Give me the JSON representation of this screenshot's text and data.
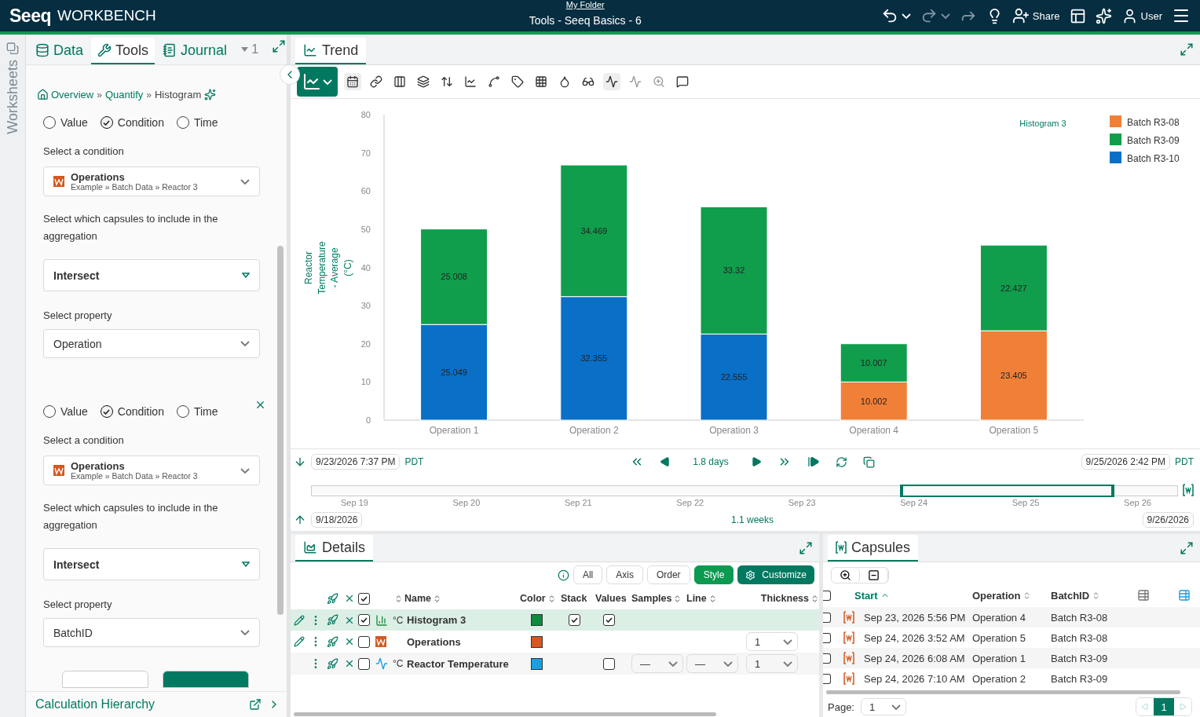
{
  "header": {
    "logo": "Seeq",
    "product": "WORKBENCH",
    "folder_link": "My Folder",
    "document_title": "Tools - Seeq Basics - 6",
    "share": "Share",
    "user": "User"
  },
  "side_tab": "Worksheets",
  "tool_tabs": [
    {
      "label": "Data",
      "selected": false
    },
    {
      "label": "Tools",
      "selected": true
    },
    {
      "label": "Journal",
      "selected": false
    }
  ],
  "tab_count": "1",
  "breadcrumbs": [
    "Overview",
    "Quantify",
    "Histogram"
  ],
  "breadcrumb_separator": "»",
  "aggregations": [
    {
      "removable": false,
      "types": [
        {
          "label": "Value",
          "selected": false
        },
        {
          "label": "Condition",
          "selected": true
        },
        {
          "label": "Time",
          "selected": false
        }
      ],
      "condition_label": "Select a condition",
      "condition": {
        "name": "Operations",
        "path": "Example » Batch Data » Reactor 3"
      },
      "capsules_label": "Select which capsules to include in the aggregation",
      "capsule_mode": "Intersect",
      "property_label": "Select property",
      "property": "Operation"
    },
    {
      "removable": true,
      "types": [
        {
          "label": "Value",
          "selected": false
        },
        {
          "label": "Condition",
          "selected": true
        },
        {
          "label": "Time",
          "selected": false
        }
      ],
      "condition_label": "Select a condition",
      "condition": {
        "name": "Operations",
        "path": "Example » Batch Data » Reactor 3"
      },
      "capsules_label": "Select which capsules to include in the aggregation",
      "capsule_mode": "Intersect",
      "property_label": "Select property",
      "property": "BatchID"
    }
  ],
  "calc_hierarchy": "Calculation Hierarchy",
  "trend_tab": "Trend",
  "chart_data": {
    "type": "bar",
    "stacked": true,
    "title": "Histogram 3",
    "ylabel": "Reactor Temperature - Average (°C)",
    "legend": true,
    "categories": [
      "Operation 1",
      "Operation 2",
      "Operation 3",
      "Operation 4",
      "Operation 5"
    ],
    "ylim": [
      0,
      80
    ],
    "yticks": [
      0,
      10,
      20,
      30,
      40,
      50,
      60,
      70,
      80
    ],
    "data_labels": true,
    "series": [
      {
        "name": "Batch R3-08",
        "color": "#f07f38",
        "values": [
          null,
          null,
          null,
          10.002,
          23.405
        ]
      },
      {
        "name": "Batch R3-10",
        "color": "#0a6fc7",
        "values": [
          25.049,
          32.355,
          22.555,
          null,
          null
        ]
      },
      {
        "name": "Batch R3-09",
        "color": "#109e4c",
        "values": [
          25.008,
          34.469,
          33.32,
          10.007,
          22.427
        ]
      }
    ]
  },
  "time_bar": {
    "start": "9/23/2026 7:37 PM",
    "start_zone": "PDT",
    "duration": "1.8 days",
    "end": "9/25/2026 2:42 PM",
    "end_zone": "PDT"
  },
  "overview": {
    "ticks": [
      "Sep 19",
      "Sep 20",
      "Sep 21",
      "Sep 22",
      "Sep 23",
      "Sep 24",
      "Sep 25",
      "Sep 26"
    ],
    "start": "9/18/2026",
    "span": "1.1 weeks",
    "end": "9/26/2026"
  },
  "details": {
    "title": "Details",
    "filters": [
      {
        "label": "All",
        "selected": false
      },
      {
        "label": "Axis",
        "selected": false
      },
      {
        "label": "Order",
        "selected": false
      },
      {
        "label": "Style",
        "selected": true
      }
    ],
    "customize": "Customize",
    "all_checked": true,
    "columns": [
      "Name",
      "Color",
      "Stack",
      "Values",
      "Samples",
      "Line",
      "Thickness"
    ],
    "rows": [
      {
        "kind": "histogram",
        "unit": "°C",
        "name": "Histogram 3",
        "color": "#0f8a3e",
        "checked": true,
        "selected": true,
        "editable": true,
        "stack": true,
        "values": true
      },
      {
        "kind": "condition",
        "name": "Operations",
        "color": "#d4581f",
        "checked": false,
        "selected": false,
        "editable": true,
        "thickness": "1"
      },
      {
        "kind": "signal",
        "unit": "°C",
        "name": "Reactor Temperature",
        "color": "#1b9fe0",
        "checked": false,
        "selected": false,
        "editable": false,
        "values": false,
        "samples": "—",
        "line": "—",
        "thickness": "1"
      }
    ]
  },
  "capsules": {
    "title": "Capsules",
    "all_checked": false,
    "columns": [
      {
        "label": "Start",
        "sorted": true
      },
      {
        "label": "Operation",
        "sorted": false
      },
      {
        "label": "BatchID",
        "sorted": false
      }
    ],
    "rows": [
      {
        "checked": false,
        "start": "Sep 23, 2026 5:56 PM",
        "operation": "Operation 4",
        "batch": "Batch R3-08"
      },
      {
        "checked": false,
        "start": "Sep 24, 2026 3:52 AM",
        "operation": "Operation 5",
        "batch": "Batch R3-08"
      },
      {
        "checked": false,
        "start": "Sep 24, 2026 6:08 AM",
        "operation": "Operation 1",
        "batch": "Batch R3-09"
      },
      {
        "checked": false,
        "start": "Sep 24, 2026 7:10 AM",
        "operation": "Operation 2",
        "batch": "Batch R3-09"
      }
    ],
    "page_label": "Page:",
    "page": "1",
    "current_page": "1"
  }
}
